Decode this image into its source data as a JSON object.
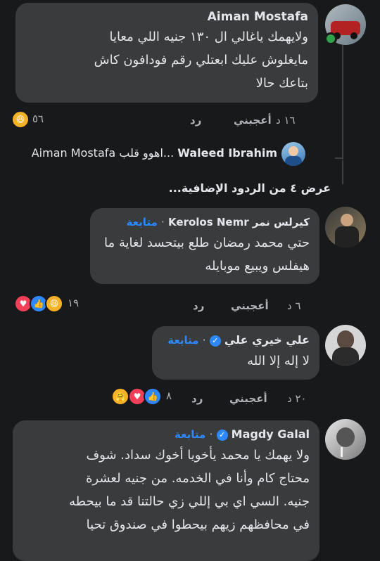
{
  "comments": [
    {
      "author": "Aiman Mostafa",
      "lines": [
        "ولايهمك ياغالي ال ١٣٠ جنيه اللي معايا",
        "مايغلوش عليك ابعتلي رقم فودافون كاش",
        "بتاعك حالا"
      ],
      "time": "١٦ د",
      "like": "أعجبني",
      "reply": "رد",
      "reaction_count": "٥٦"
    },
    {
      "author": "Kerolos Nemr",
      "author_alt": "كيرلس نمر",
      "follow": "متابعة",
      "lines": [
        "حتي محمد رمضان طلع بيتحسد لغاية ما",
        "هيفلس ويبيع موبايله"
      ],
      "time": "٦ د",
      "like": "أعجبني",
      "reply": "رد",
      "reaction_count": "١٩"
    },
    {
      "author": "علي خيري علي",
      "follow": "متابعة",
      "lines": [
        "لا إله إلا الله"
      ],
      "time": "٢٠ د",
      "like": "أعجبني",
      "reply": "رد",
      "reaction_count": "٨"
    },
    {
      "author": "Magdy Galal",
      "follow": "متابعة",
      "lines": [
        "ولا يهمك يا محمد يأخويا أخوك سداد. شوف",
        "محتاج كام وأنا في الخدمه. من جنيه لعشرة",
        "جنيه. السي اي بي إللي زي حالتنا قد ما بيحطه",
        "في محافظهم زيهم بيحطوا في صندوق تحيا"
      ]
    }
  ],
  "reply_preview": {
    "author": "Waleed Ibrahim",
    "snippet": "اهوو قلب...",
    "mention": "Aiman Mostafa"
  },
  "more_replies": "عرض ٤ من الردود الإضافية...",
  "dot_sep": "·",
  "colors": {
    "background": "#18191a",
    "bubble": "#3a3b3c",
    "link": "#2d88ff",
    "online": "#31a24c"
  }
}
